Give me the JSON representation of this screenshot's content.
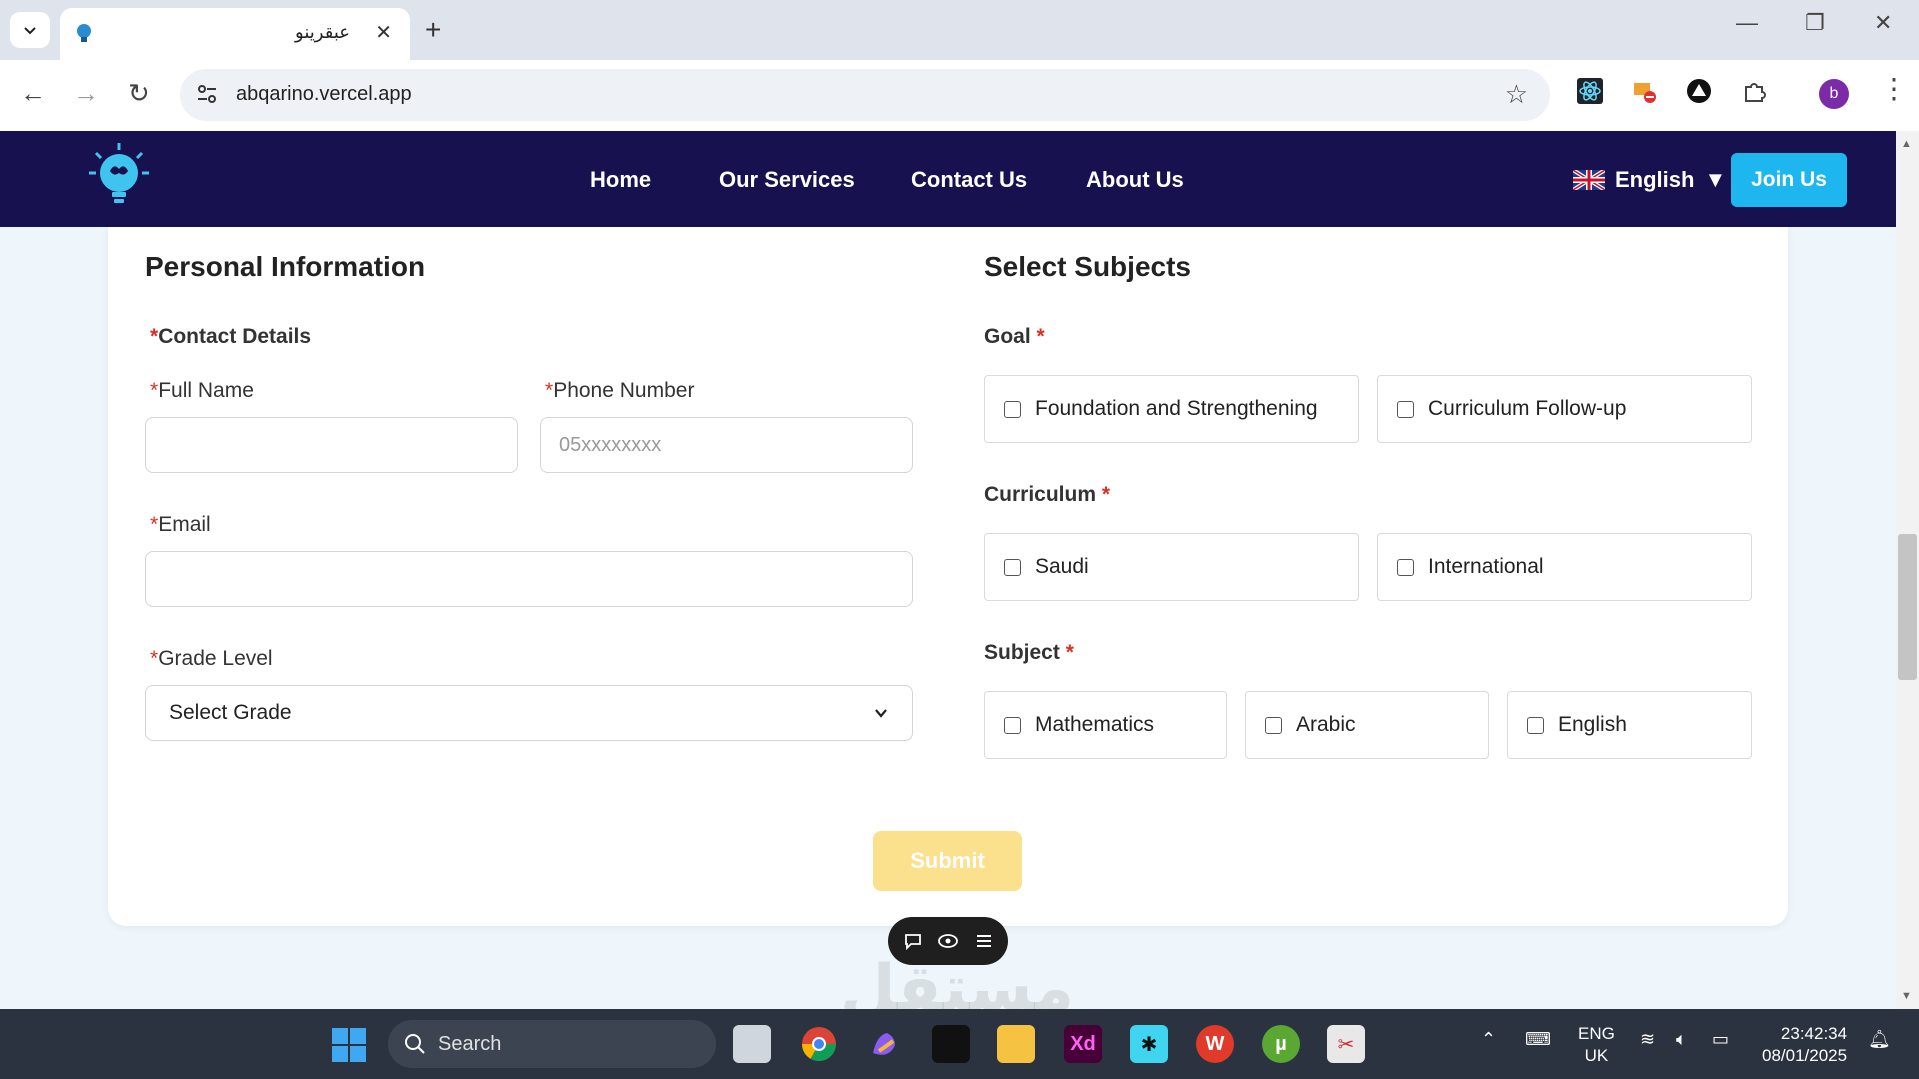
{
  "browser": {
    "tab_title": "عبقرينو",
    "url": "abqarino.vercel.app",
    "profile_initial": "b"
  },
  "site_nav": {
    "links": [
      "Home",
      "Our Services",
      "Contact Us",
      "About Us"
    ],
    "language": "English",
    "language_caret": "▼",
    "join_label": "Join Us"
  },
  "personal": {
    "title": "Personal Information",
    "contact_details": "Contact Details",
    "full_name_label": "Full Name",
    "phone_label": "Phone Number",
    "phone_placeholder": "05xxxxxxxx",
    "email_label": "Email",
    "grade_label": "Grade Level",
    "grade_selected": "Select Grade",
    "required_mark": "*"
  },
  "subjects": {
    "title": "Select Subjects",
    "goal_label": "Goal",
    "goal_options": [
      "Foundation and Strengthening",
      "Curriculum Follow-up"
    ],
    "curriculum_label": "Curriculum",
    "curriculum_options": [
      "Saudi",
      "International"
    ],
    "subject_label": "Subject",
    "subject_options": [
      "Mathematics",
      "Arabic",
      "English"
    ]
  },
  "submit_label": "Submit",
  "watermark": "مستقل",
  "taskbar": {
    "search_label": "Search",
    "lang_line1": "ENG",
    "lang_line2": "UK",
    "time": "23:42:34",
    "date": "08/01/2025"
  },
  "colors": {
    "nav_bg": "#17124f",
    "join_bg": "#1db6ee",
    "submit_bg": "#fbe08e",
    "required": "#d93025"
  }
}
